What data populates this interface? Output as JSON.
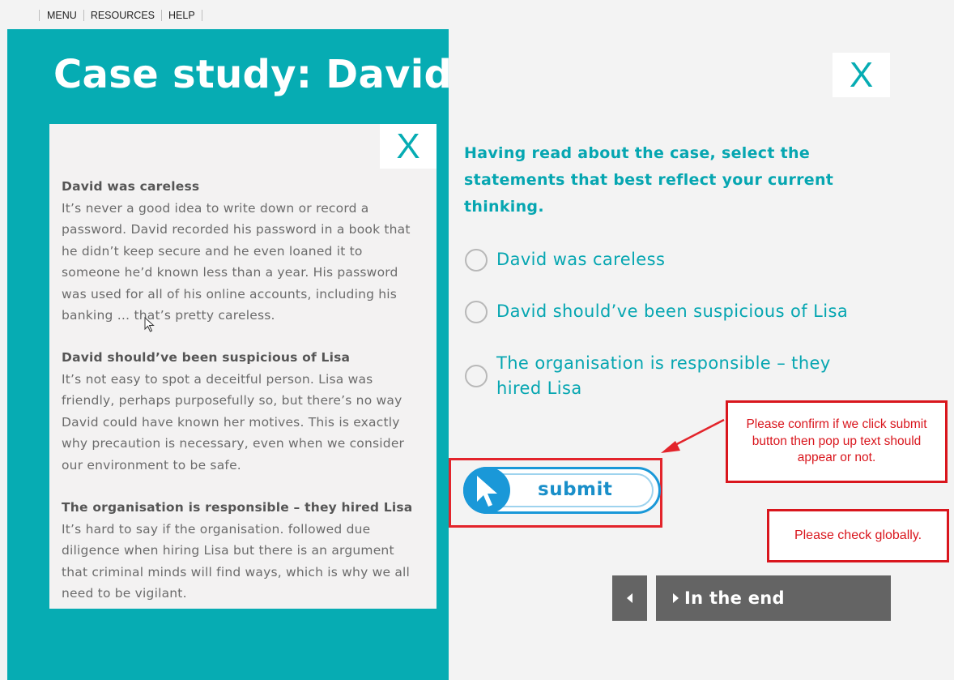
{
  "topmenu": {
    "items": [
      {
        "label": "MENU"
      },
      {
        "label": "RESOURCES"
      },
      {
        "label": "HELP"
      }
    ]
  },
  "panel": {
    "title": "Case study: David",
    "close_label": "X",
    "statements": [
      {
        "heading": "David was careless",
        "body": "It’s never a good idea to write down or record a password. David recorded his password in a book that he didn’t keep secure and he even loaned it to someone he’d known less than a year. His password was used for all of his online accounts, including his banking … that’s pretty careless."
      },
      {
        "heading": "David should’ve been suspicious of Lisa",
        "body": "It’s not easy to spot a deceitful person. Lisa was friendly, perhaps purposefully so, but there’s no way David could have known her motives. This is exactly why precaution is necessary, even when we consider our environment to be safe."
      },
      {
        "heading": "The organisation is responsible – they hired Lisa",
        "body": "It’s hard to say if the organisation. followed due diligence when hiring Lisa but there is an argument that criminal minds will find ways, which is why we all need to be vigilant."
      }
    ]
  },
  "main": {
    "close_label": "X",
    "question": "Having read about the case, select the statements that best reflect your current thinking.",
    "options": [
      {
        "label": "David was careless"
      },
      {
        "label": "David should’ve been suspicious of Lisa"
      },
      {
        "label": "The organisation is responsible – they hired Lisa"
      }
    ],
    "submit_label": "submit"
  },
  "annotations": {
    "note1": "Please confirm if we click submit button then pop up text should appear or not.",
    "note2": "Please check globally."
  },
  "nav": {
    "next_label": "In the end"
  },
  "colors": {
    "teal": "#06acb3",
    "submit_blue": "#1a98d8",
    "annotation_red": "#d9161d",
    "nav_gray": "#646464"
  }
}
